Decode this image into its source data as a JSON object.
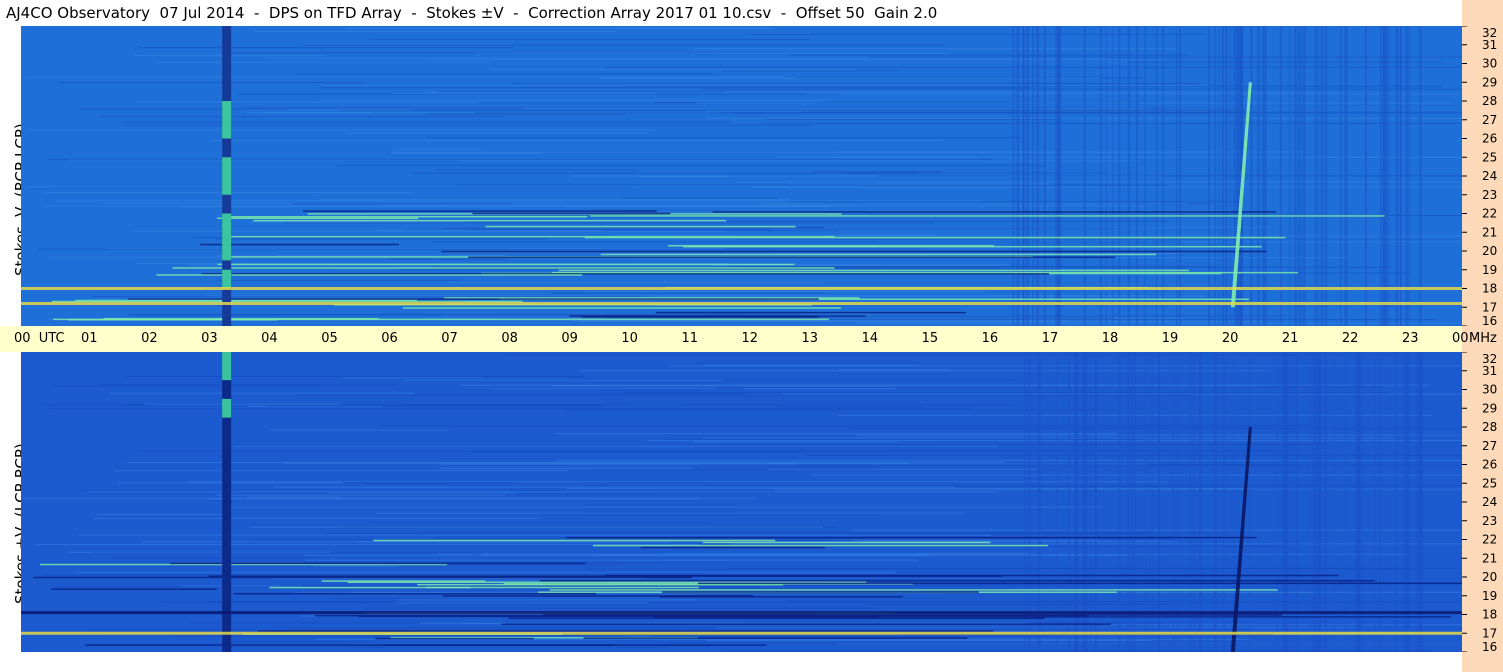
{
  "title": "AJ4CO Observatory  07 Jul 2014  -  DPS on TFD Array  -  Stokes ±V  -  Correction Array 2017 01 10.csv  -  Offset 50  Gain 2.0",
  "colors": {
    "base_top": "#1f6fd8",
    "base_bottom": "#1c5ad0",
    "gutter": "#fcd9b8",
    "time_axis": "#ffffcc"
  },
  "time_axis": {
    "labels": [
      "00  UTC",
      "01",
      "02",
      "03",
      "04",
      "05",
      "06",
      "07",
      "08",
      "09",
      "10",
      "11",
      "12",
      "13",
      "14",
      "15",
      "16",
      "17",
      "18",
      "19",
      "20",
      "21",
      "22",
      "23",
      "00"
    ],
    "unit": "MHz"
  },
  "chart_data": [
    {
      "type": "heatmap",
      "panel": "top",
      "ylabel": "Stokes -V  (RCP-LCP)",
      "x_unit": "UTC hour",
      "x_range": [
        0,
        24
      ],
      "y_unit": "MHz",
      "y_range": [
        16,
        32
      ],
      "y_ticks": [
        32,
        31,
        30,
        29,
        28,
        27,
        26,
        25,
        24,
        23,
        22,
        21,
        20,
        19,
        18,
        17,
        16
      ],
      "features": [
        {
          "kind": "vertical_band",
          "start_hour": 3.35,
          "end_hour": 3.5,
          "description": "broadband stripe with bright segments"
        },
        {
          "kind": "burst",
          "start_hour": 20.15,
          "end_hour": 20.45,
          "low_mhz": 17,
          "high_mhz": 29,
          "polarity": "bright"
        },
        {
          "kind": "horizontal_band",
          "mhz": 18.0,
          "polarity": "bright"
        },
        {
          "kind": "horizontal_band",
          "mhz": 17.2,
          "polarity": "bright"
        }
      ]
    },
    {
      "type": "heatmap",
      "panel": "bottom",
      "ylabel": "Stokes +V  (LCP-RCP)",
      "x_unit": "UTC hour",
      "x_range": [
        0,
        24
      ],
      "y_unit": "MHz",
      "y_range": [
        16,
        32
      ],
      "y_ticks": [
        32,
        31,
        30,
        29,
        28,
        27,
        26,
        25,
        24,
        23,
        22,
        21,
        20,
        19,
        18,
        17,
        16
      ],
      "features": [
        {
          "kind": "vertical_band",
          "start_hour": 3.35,
          "end_hour": 3.5,
          "description": "broadband dark stripe with bright top"
        },
        {
          "kind": "burst",
          "start_hour": 20.15,
          "end_hour": 20.45,
          "low_mhz": 16,
          "high_mhz": 28,
          "polarity": "dark"
        },
        {
          "kind": "horizontal_band",
          "mhz": 18.1,
          "polarity": "dark"
        },
        {
          "kind": "horizontal_band",
          "mhz": 17.0,
          "polarity": "bright"
        }
      ]
    }
  ]
}
